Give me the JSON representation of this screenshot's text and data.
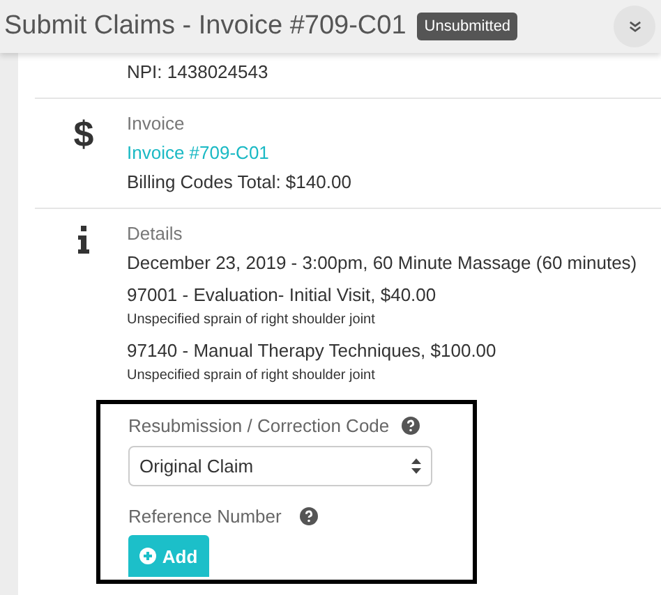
{
  "header": {
    "title": "Submit Claims - Invoice #709-C01",
    "status_badge": "Unsubmitted"
  },
  "sections": [
    {
      "kind": "text",
      "lines": [
        "NPI: 1438024543"
      ]
    },
    {
      "kind": "invoice",
      "icon": "$",
      "heading": "Invoice",
      "link": "Invoice #709-C01",
      "lines": [
        "Billing Codes Total: $140.00"
      ]
    },
    {
      "kind": "details",
      "heading": "Details",
      "lines": [
        "December 23, 2019 - 3:00pm, 60 Minute Massage (60 minutes)"
      ],
      "items": [
        {
          "title": "97001 - Evaluation- Initial Visit, $40.00",
          "note": "Unspecified sprain of right shoulder joint"
        },
        {
          "title": "97140 - Manual Therapy Techniques, $100.00",
          "note": "Unspecified sprain of right shoulder joint"
        }
      ]
    }
  ],
  "form": {
    "resubmission_label": "Resubmission / Correction Code",
    "resubmission_value": "Original Claim",
    "reference_label": "Reference Number",
    "add_button": "Add"
  }
}
